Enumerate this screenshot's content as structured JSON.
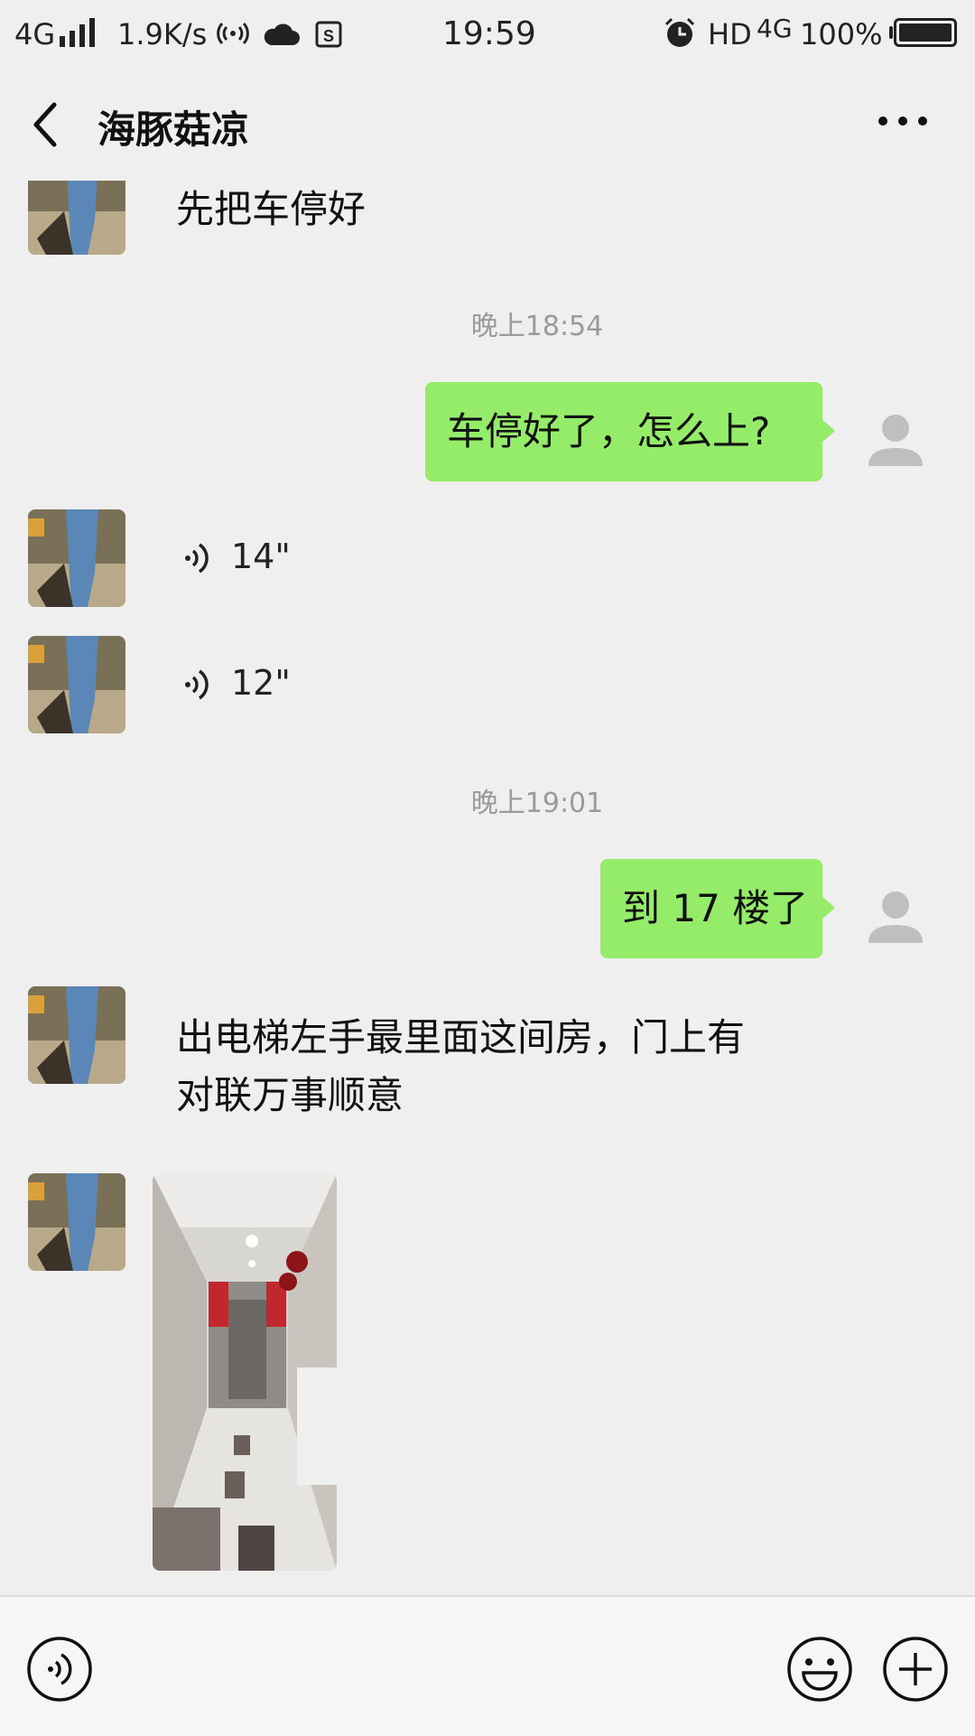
{
  "status_bar": {
    "network": "4G",
    "speed": "1.9K/s",
    "time": "19:59",
    "hd": "HD",
    "network2": "4G",
    "battery": "100%"
  },
  "header": {
    "title": "海豚菇凉"
  },
  "messages": {
    "m1_text": "先把车停好",
    "ts1": "晚上18:54",
    "m2_text": "车停好了，怎么上?",
    "voice1_duration": "14\"",
    "voice2_duration": "12\"",
    "ts2": "晚上19:01",
    "m3_text": "到 17 楼了",
    "m4_line1": "出电梯左手最里面这间房，门上有",
    "m4_line2": "对联万事顺意"
  },
  "colors": {
    "bubble_out": "#95ec69",
    "background": "#efefef"
  }
}
